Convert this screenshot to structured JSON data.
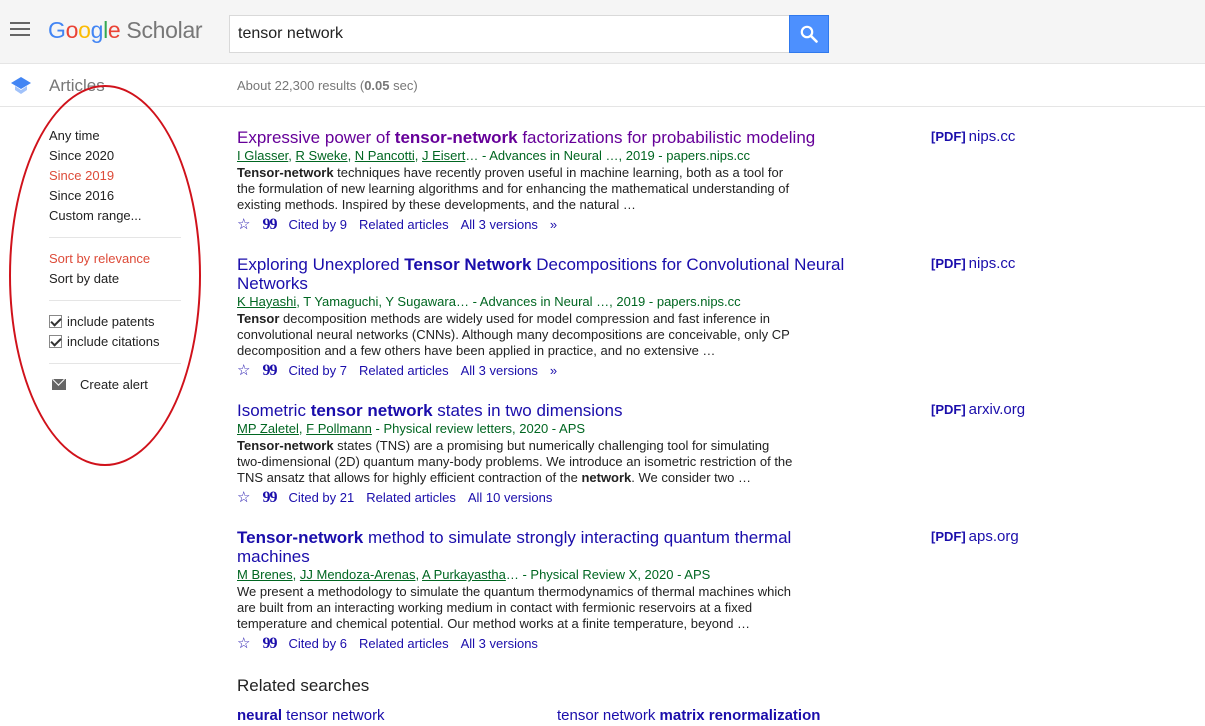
{
  "header": {
    "logo_google": [
      "G",
      "o",
      "o",
      "g",
      "l",
      "e"
    ],
    "logo_scholar": "Scholar",
    "search_value": "tensor network"
  },
  "subheader": {
    "section": "Articles",
    "results_prefix": "About 22,300 results (",
    "results_time": "0.05",
    "results_suffix": " sec)"
  },
  "sidebar": {
    "time_filters": [
      "Any time",
      "Since 2020",
      "Since 2019",
      "Since 2016",
      "Custom range..."
    ],
    "selected_time": "Since 2019",
    "sort": [
      "Sort by relevance",
      "Sort by date"
    ],
    "selected_sort": "Sort by relevance",
    "checkboxes": [
      "include patents",
      "include citations"
    ],
    "create_alert": "Create alert"
  },
  "results": [
    {
      "title_parts": [
        "Expressive power of ",
        "tensor-network",
        " factorizations for probabilistic modeling"
      ],
      "authors": [
        "I Glasser",
        "R Sweke",
        "N Pancotti",
        "J Eisert"
      ],
      "source": "… - Advances in Neural …, 2019 - papers.nips.cc",
      "snippet_bold": "Tensor-network",
      "snippet": " techniques have recently proven useful in machine learning, both as a tool for the formulation of new learning algorithms and for enhancing the mathematical understanding of existing methods. Inspired by these developments, and the natural …",
      "cited": "Cited by 9",
      "related": "Related articles",
      "versions": "All 3 versions",
      "pdf_tag": "[PDF]",
      "pdf_host": "nips.cc"
    },
    {
      "title_parts": [
        "Exploring Unexplored ",
        "Tensor Network",
        " Decompositions for Convolutional Neural Networks"
      ],
      "authors": [
        "K Hayashi"
      ],
      "source": ", T Yamaguchi, Y Sugawara… - Advances in Neural …, 2019 - papers.nips.cc",
      "snippet_bold": "Tensor",
      "snippet": " decomposition methods are widely used for model compression and fast inference in convolutional neural networks (CNNs). Although many decompositions are conceivable, only CP decomposition and a few others have been applied in practice, and no extensive …",
      "cited": "Cited by 7",
      "related": "Related articles",
      "versions": "All 3 versions",
      "pdf_tag": "[PDF]",
      "pdf_host": "nips.cc"
    },
    {
      "title_parts": [
        "Isometric ",
        "tensor network",
        " states in two dimensions"
      ],
      "authors": [
        "MP Zaletel",
        "F Pollmann"
      ],
      "source": " - Physical review letters, 2020 - APS",
      "snippet_bold": "Tensor-network",
      "snippet": " states (TNS) are a promising but numerically challenging tool for simulating two-dimensional (2D) quantum many-body problems. We introduce an isometric restriction of the TNS ansatz that allows for highly efficient contraction of the ",
      "snippet_bold2": "network",
      "snippet_tail": ". We consider two …",
      "cited": "Cited by 21",
      "related": "Related articles",
      "versions": "All 10 versions",
      "pdf_tag": "[PDF]",
      "pdf_host": "arxiv.org"
    },
    {
      "title_parts": [
        "",
        "Tensor-network",
        " method to simulate strongly interacting quantum thermal machines"
      ],
      "authors": [
        "M Brenes",
        "JJ Mendoza-Arenas",
        "A Purkayastha"
      ],
      "source": "… - Physical Review X, 2020 - APS",
      "snippet_bold": "",
      "snippet": "We present a methodology to simulate the quantum thermodynamics of thermal machines which are built from an interacting working medium in contact with fermionic reservoirs at a fixed temperature and chemical potential. Our method works at a finite temperature, beyond …",
      "cited": "Cited by 6",
      "related": "Related articles",
      "versions": "All 3 versions",
      "pdf_tag": "[PDF]",
      "pdf_host": "aps.org"
    }
  ],
  "related_searches": {
    "heading": "Related searches",
    "items": [
      {
        "bold": "neural",
        "rest": " tensor network"
      },
      {
        "plain": "tensor network ",
        "bold": "matrix renormalization"
      }
    ]
  }
}
